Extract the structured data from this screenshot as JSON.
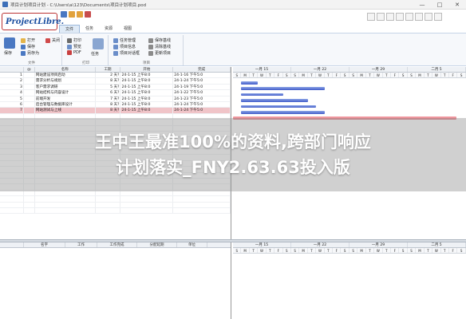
{
  "window": {
    "title": "项目计划项目计划 - C:\\Users\\a\\123\\Documents\\项目计划项目.pod"
  },
  "app": {
    "logo": "ProjectLibre."
  },
  "ribbon": {
    "tabs": [
      "文件",
      "任务",
      "资源",
      "视图"
    ],
    "active_tab": "文件",
    "groups": [
      {
        "label": "文件",
        "buttons": [
          "打开",
          "保存",
          "另存为",
          "关闭"
        ]
      },
      {
        "label": "打印",
        "buttons": [
          "打印",
          "预览",
          "PDF"
        ]
      },
      {
        "label": "项目",
        "buttons": [
          "任务管理",
          "项目信息",
          "项目对话框",
          "保存基线",
          "清除基线",
          "更新项目"
        ]
      }
    ],
    "save_label": "保存",
    "task_label": "任务"
  },
  "task_table": {
    "columns": [
      "",
      "@",
      "名称",
      "工期",
      "开始",
      "完成"
    ],
    "rows": [
      {
        "id": "1",
        "name": "网站建设项目启动",
        "duration": "2 天?",
        "start": "24-1-15 上午8:0",
        "finish": "24-1-16 下午5:0"
      },
      {
        "id": "2",
        "name": "需求分析与规划",
        "duration": "8 天?",
        "start": "24-1-15 上午8:0",
        "finish": "24-1-24 下午5:0"
      },
      {
        "id": "3",
        "name": "客户需求调研",
        "duration": "5 天?",
        "start": "24-1-15 上午8:0",
        "finish": "24-1-19 下午5:0"
      },
      {
        "id": "4",
        "name": "网站结构与内容设计",
        "duration": "6 天?",
        "start": "24-1-15 上午8:0",
        "finish": "24-1-22 下午5:0"
      },
      {
        "id": "5",
        "name": "前端开发",
        "duration": "7 天?",
        "start": "24-1-15 上午8:0",
        "finish": "24-1-23 下午5:0"
      },
      {
        "id": "6",
        "name": "后台管理与数据库设计",
        "duration": "8 天?",
        "start": "24-1-15 上午8:0",
        "finish": "24-1-24 下午5:0"
      },
      {
        "id": "7",
        "name": "网站测试与上线",
        "duration": "8 天?",
        "start": "24-1-15 上午8:0",
        "finish": "24-1-24 下午5:0"
      }
    ]
  },
  "gantt": {
    "weeks": [
      "一月 15",
      "一月 22",
      "一月 29",
      "二月 5"
    ],
    "days": [
      "S",
      "M",
      "T",
      "W",
      "T",
      "F",
      "S",
      "S",
      "M",
      "T",
      "W",
      "T",
      "F",
      "S",
      "S",
      "M",
      "T",
      "W",
      "T",
      "F",
      "S",
      "S",
      "M",
      "T",
      "W",
      "T",
      "F",
      "S"
    ]
  },
  "resource_table": {
    "columns": [
      "",
      "名字",
      "工作",
      "工作完成",
      "分配延期",
      "单位"
    ]
  },
  "watermark": {
    "line1": "王中王最准100%的资料,跨部门响应",
    "line2": "计划落实_FNY2.63.63投入版"
  }
}
